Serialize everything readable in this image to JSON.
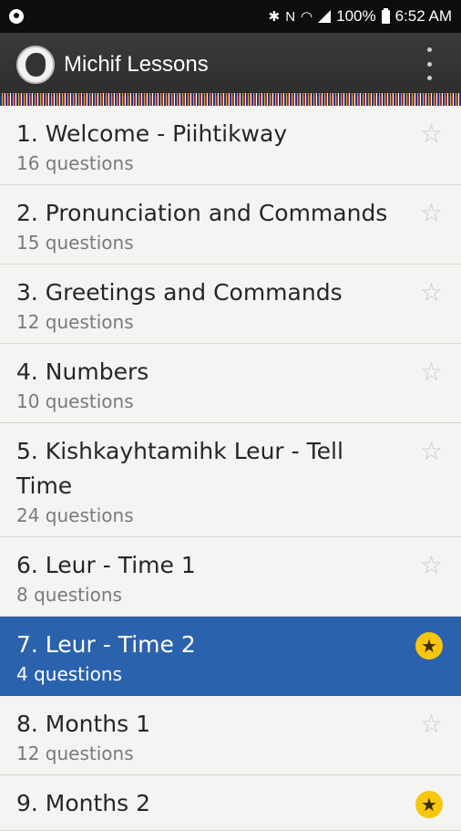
{
  "status": {
    "battery": "100%",
    "time": "6:52 AM"
  },
  "app": {
    "title": "Michif Lessons"
  },
  "lessons": [
    {
      "title": "1. Welcome - Piihtikway",
      "sub": "16 questions",
      "starred": false
    },
    {
      "title": "2. Pronunciation and Commands",
      "sub": "15 questions",
      "starred": false
    },
    {
      "title": "3. Greetings and Commands",
      "sub": "12 questions",
      "starred": false
    },
    {
      "title": "4. Numbers",
      "sub": "10 questions",
      "starred": false
    },
    {
      "title": "5. Kishkayhtamihk Leur - Tell Time",
      "sub": "24 questions",
      "starred": false
    },
    {
      "title": "6. Leur - Time 1",
      "sub": "8 questions",
      "starred": false
    },
    {
      "title": "7. Leur - Time 2",
      "sub": "4 questions",
      "starred": true,
      "selected": true
    },
    {
      "title": "8. Months 1",
      "sub": "12 questions",
      "starred": false
    },
    {
      "title": "9. Months 2",
      "sub": "",
      "starred": true
    }
  ],
  "icons": {
    "star_empty": "☆",
    "star_filled": "★"
  },
  "colors": {
    "selected_bg": "#2b62ad",
    "star_on": "#f7c60d"
  }
}
